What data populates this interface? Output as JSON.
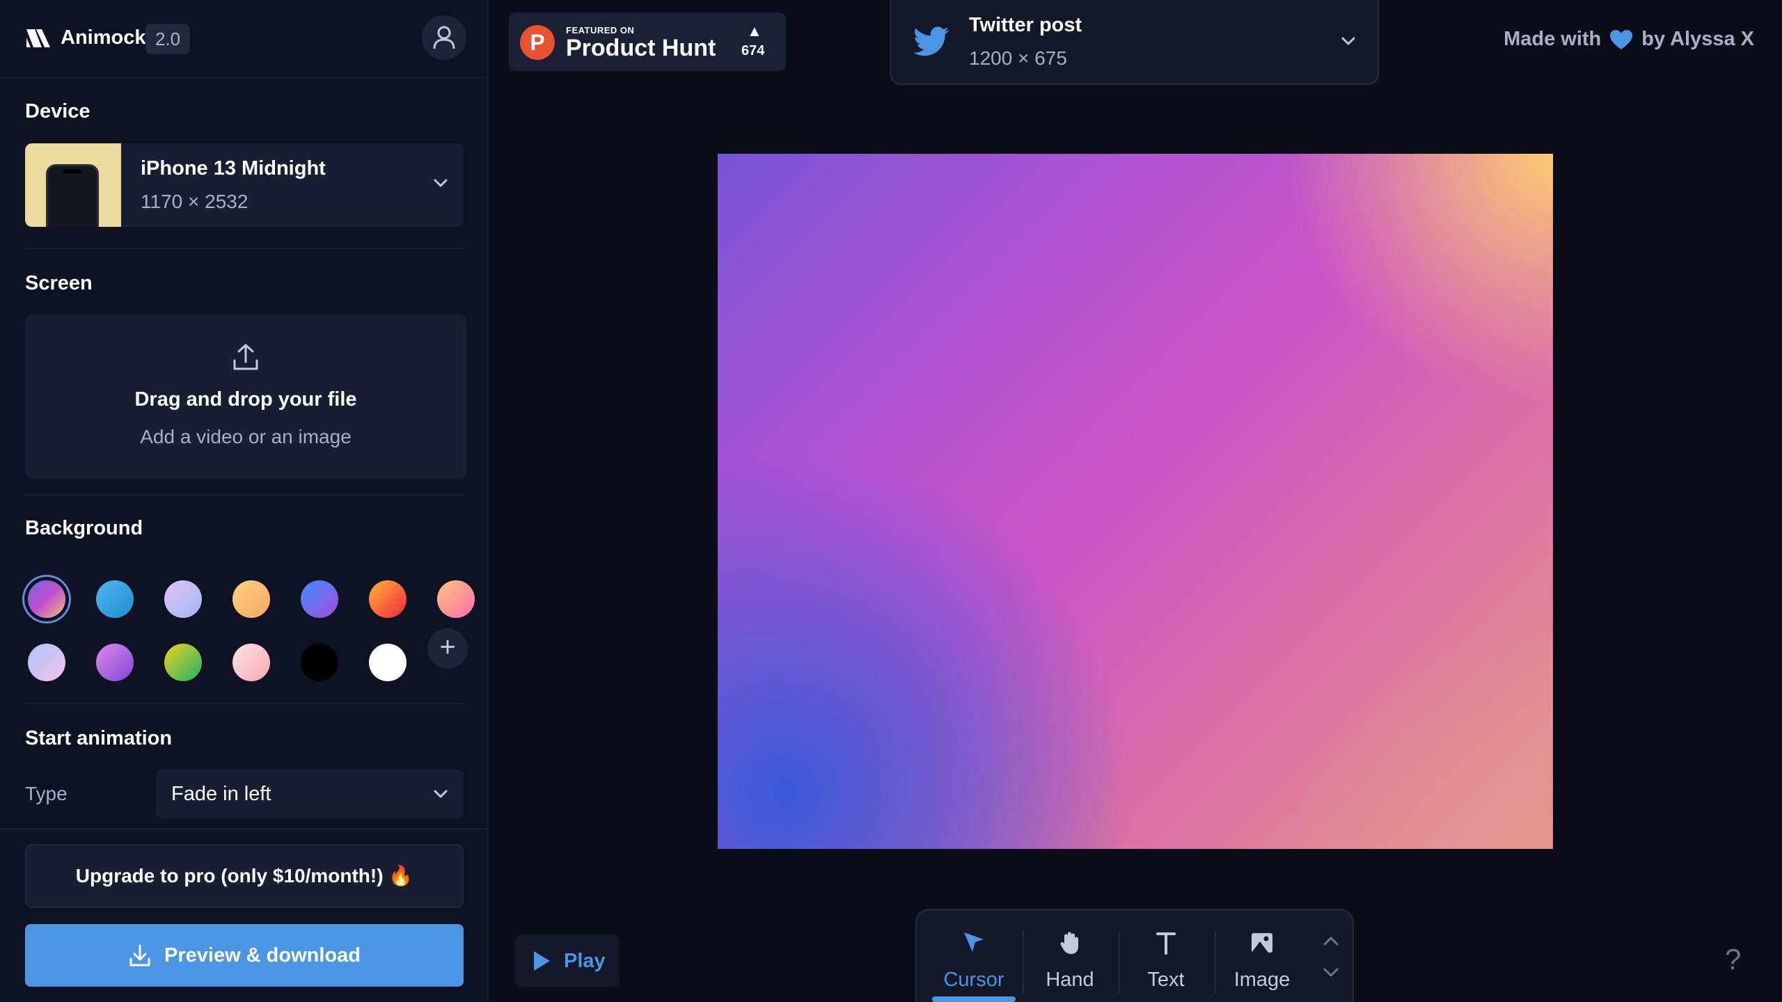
{
  "app": {
    "name": "Animockup",
    "version": "2.0"
  },
  "icons": {
    "logo": "animockup-logo-icon",
    "user": "user-icon",
    "chevron": "chevron-down-icon",
    "upload": "upload-icon",
    "plus": "plus-icon",
    "download": "download-icon",
    "play": "play-icon",
    "twitter": "twitter-icon",
    "heart": "heart-icon",
    "help": "question-icon"
  },
  "sidebar": {
    "device": {
      "title": "Device",
      "name": "iPhone 13 Midnight",
      "size": "1170 × 2532"
    },
    "screen": {
      "title": "Screen",
      "drop_title": "Drag and drop your file",
      "drop_subtitle": "Add a video or an image"
    },
    "background": {
      "title": "Background",
      "selected_index": 0,
      "swatches": [
        "linear-gradient(135deg,#6e6ad6,#c04fcf,#f6c078)",
        "linear-gradient(135deg,#4fb7ee,#1e8fd0)",
        "linear-gradient(135deg,#e4c2f6,#9cb8f4)",
        "linear-gradient(135deg,#ffd27a,#f3a66a)",
        "linear-gradient(135deg,#3f8dff,#a04ddb)",
        "linear-gradient(135deg,#ffb43a,#f2263e)",
        "linear-gradient(135deg,#ffc47a,#ff6fae)",
        "linear-gradient(135deg,#a8c6ff,#f7c0e8)",
        "linear-gradient(135deg,#e08ae8,#7b47d8)",
        "linear-gradient(135deg,#f2d11e,#19b36b)",
        "linear-gradient(135deg,#ffe2e0,#f6a9b6)",
        "#000000",
        "#ffffff"
      ],
      "add_label": "+"
    },
    "animation": {
      "title": "Start animation",
      "type_label": "Type",
      "type_value": "Fade in left"
    },
    "upgrade_label": "Upgrade to pro (only $10/month!) 🔥",
    "download_label": "Preview & download"
  },
  "product_hunt": {
    "featured": "FEATURED ON",
    "name": "Product Hunt",
    "upvotes": "674"
  },
  "format": {
    "name": "Twitter post",
    "size": "1200 × 675"
  },
  "credit": {
    "made_with": "Made with",
    "by": "by Alyssa X"
  },
  "canvas": {
    "background_colors": [
      "#4a5fd8",
      "#c954c8",
      "#ffce6e"
    ]
  },
  "controls": {
    "play_label": "Play",
    "tools": [
      {
        "label": "Cursor",
        "icon": "cursor-icon",
        "active": true
      },
      {
        "label": "Hand",
        "icon": "hand-icon",
        "active": false
      },
      {
        "label": "Text",
        "icon": "text-icon",
        "active": false
      },
      {
        "label": "Image",
        "icon": "image-icon",
        "active": false
      }
    ],
    "help_label": "?"
  },
  "colors": {
    "accent": "#4a96e4",
    "background": "#0b0d18",
    "panel": "#1a1e33"
  }
}
